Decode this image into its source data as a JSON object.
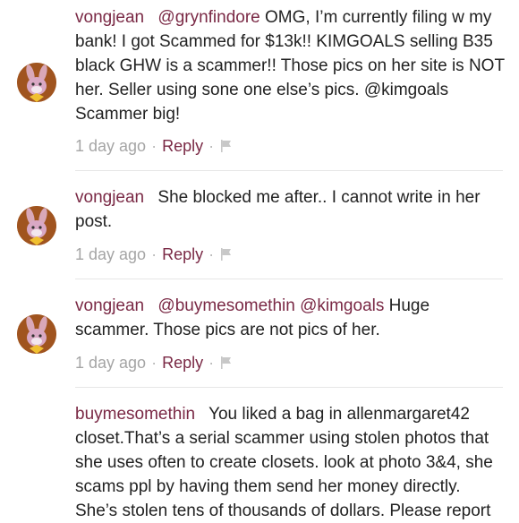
{
  "comments": [
    {
      "username": "vongjean",
      "mention": "@grynfindore",
      "text": "OMG, I’m currently filing w my bank! I got Scammed for $13k!! KIMGOALS selling B35 black GHW is a scammer!! Those pics on her site is NOT her. Seller using sone one else’s pics. @kimgoals Scammer big!",
      "time": "1 day ago",
      "reply": "Reply"
    },
    {
      "username": "vongjean",
      "mention": "",
      "text": "She blocked me after.. I cannot write in her post.",
      "time": "1 day ago",
      "reply": "Reply"
    },
    {
      "username": "vongjean",
      "mention": "@buymesomethin @kimgoals",
      "text": "Huge scammer. Those pics are not pics of her.",
      "time": "1 day ago",
      "reply": "Reply"
    },
    {
      "username": "buymesomethin",
      "mention": "",
      "text": "You liked a bag in allenmargaret42 closet.That’s a serial scammer using stolen photos that she uses often to create closets. look at photo 3&4, she scams ppl by having them send her money directly. She’s stolen tens of thousands of dollars. Please report",
      "time": "",
      "reply": ""
    }
  ],
  "separator": "·",
  "colors": {
    "accent": "#7a2945",
    "meta": "#a5a5a5",
    "text": "#222222",
    "divider": "#e6e6e6"
  },
  "icons": {
    "flag": "flag-icon",
    "avatar": "bunny-avatar-icon"
  }
}
